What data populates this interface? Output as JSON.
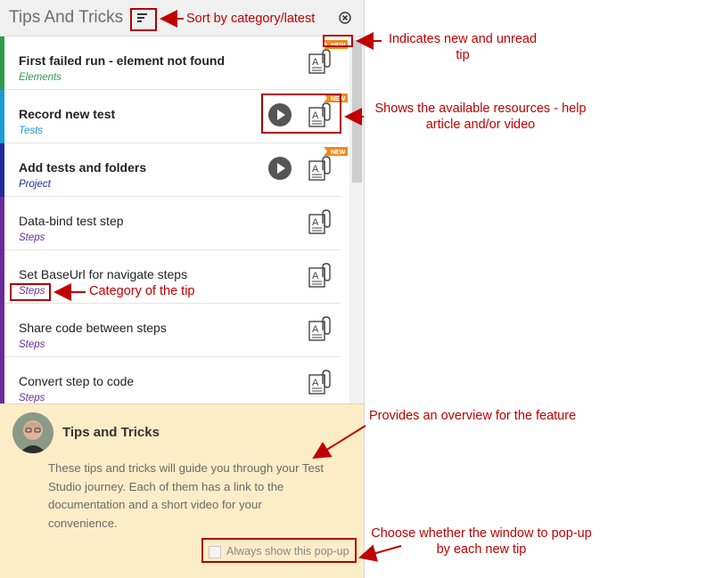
{
  "panel": {
    "title": "Tips And Tricks",
    "sort_icon": "sort-icon",
    "close_icon": "close-circle-icon"
  },
  "tips": [
    {
      "name": "First failed run - element not found",
      "category": "Elements",
      "color": "#2e9c4a",
      "unread": true,
      "is_new": true,
      "has_video": false
    },
    {
      "name": "Record new test",
      "category": "Tests",
      "color": "#1e9bd7",
      "unread": true,
      "is_new": true,
      "has_video": true
    },
    {
      "name": "Add tests and folders",
      "category": "Project",
      "color": "#1d2a9c",
      "unread": true,
      "is_new": true,
      "has_video": true
    },
    {
      "name": "Data-bind test step",
      "category": "Steps",
      "color": "#6a2c9c",
      "unread": false,
      "is_new": false,
      "has_video": false
    },
    {
      "name": "Set BaseUrl for navigate steps",
      "category": "Steps",
      "color": "#6a2c9c",
      "unread": false,
      "is_new": false,
      "has_video": false
    },
    {
      "name": "Share code between steps",
      "category": "Steps",
      "color": "#6a2c9c",
      "unread": false,
      "is_new": false,
      "has_video": false
    },
    {
      "name": "Convert step to code",
      "category": "Steps",
      "color": "#6a2c9c",
      "unread": false,
      "is_new": false,
      "has_video": false
    }
  ],
  "badge": {
    "new_label": "NEW",
    "color": "#f08a1c"
  },
  "footer": {
    "title": "Tips and Tricks",
    "description": "These tips and tricks will guide you through your Test Studio journey. Each of them has a link to the documentation and a short video for your convenience.",
    "checkbox_label": "Always show this pop-up",
    "checkbox_checked": false,
    "background": "#fdedc7"
  },
  "annotations": {
    "sort": "Sort by category/latest",
    "new_tip": "Indicates new and unread tip",
    "resources": "Shows the available resources - help article and/or video",
    "category": "Category of the tip",
    "overview": "Provides an overview for the feature",
    "popup": "Choose whether the window to pop-up by each new tip",
    "color": "#c00000"
  }
}
